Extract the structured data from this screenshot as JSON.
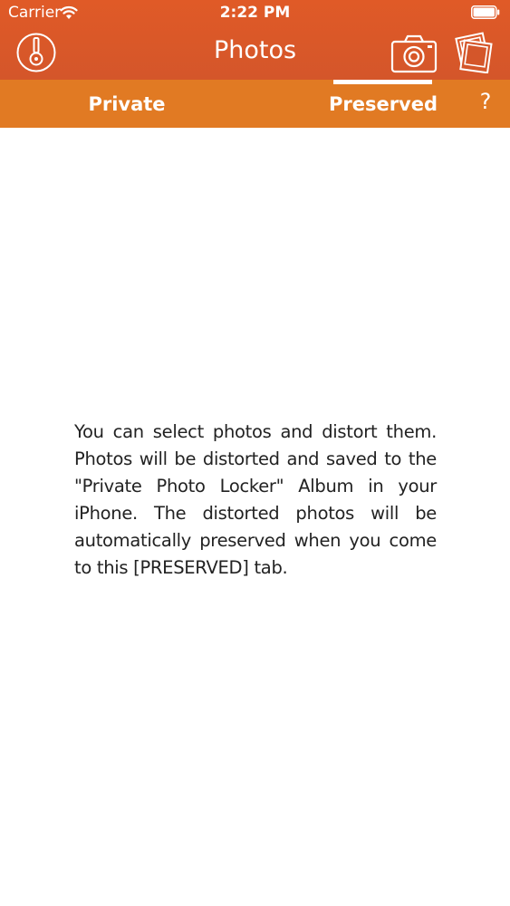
{
  "status_bar": {
    "carrier": "Carrier",
    "time": "2:22 PM"
  },
  "header": {
    "title": "Photos",
    "background_color": "#d4562a"
  },
  "tabs": {
    "background_color": "#e17a23",
    "items": [
      {
        "label": "Private",
        "active": false
      },
      {
        "label": "Preserved",
        "active": true
      }
    ],
    "help_label": "?"
  },
  "main": {
    "info_text": "You can select photos and distort them. Photos will be distorted and saved to the \"Private Photo Locker\" Album in your iPhone. The distorted photos will be automatically preserved when you come to this [PRESERVED] tab."
  }
}
